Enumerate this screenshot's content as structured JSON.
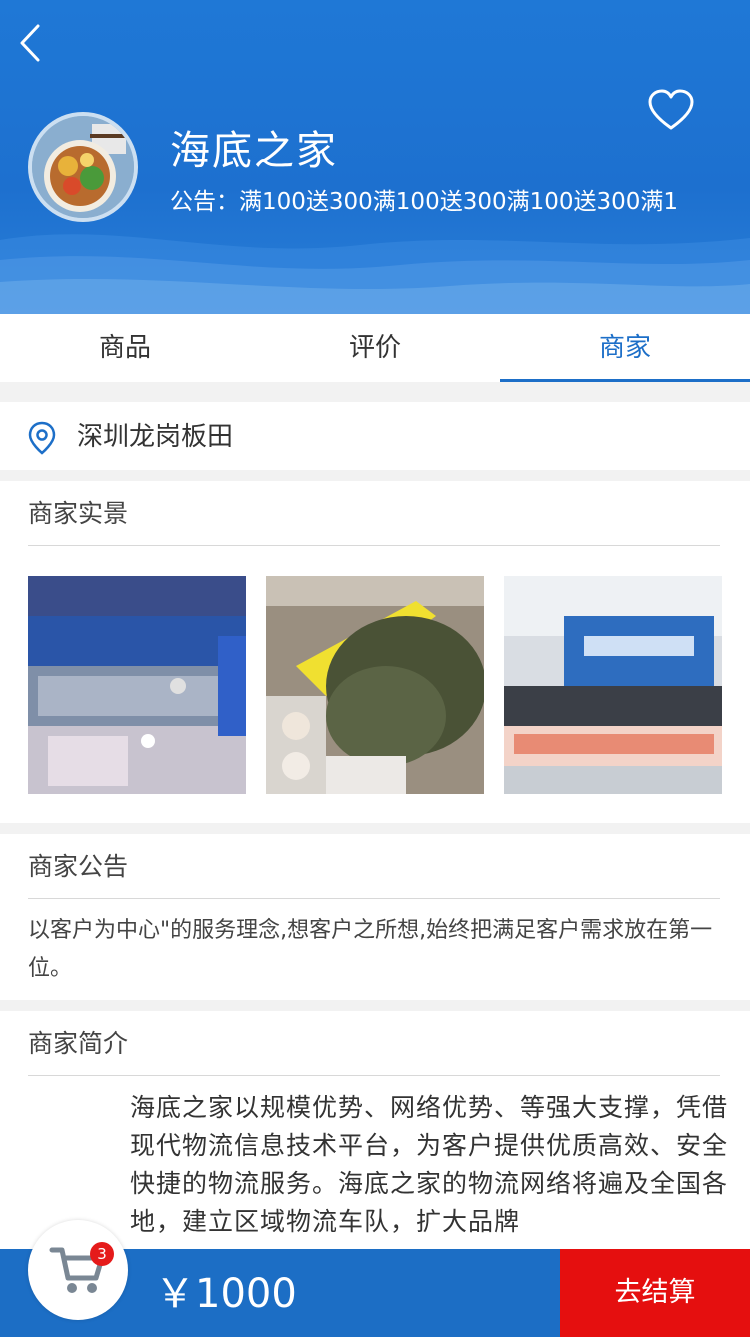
{
  "header": {
    "shop_name": "海底之家",
    "notice_prefix": "公告：",
    "notice_text": "满100送300满100送300满100送300满1"
  },
  "icons": {
    "back": "chevron-left-icon",
    "favorite": "heart-outline-icon",
    "location": "location-pin-icon",
    "cart": "shopping-cart-icon"
  },
  "tabs": [
    {
      "label": "商品"
    },
    {
      "label": "评价"
    },
    {
      "label": "商家"
    }
  ],
  "active_tab": "商家",
  "address": {
    "text": "深圳龙岗板田"
  },
  "scene": {
    "title": "商家实景"
  },
  "notice_section": {
    "title": "商家公告",
    "body": "以客户为中心\"的服务理念,想客户之所想,始终把满足客户需求放在第一位。"
  },
  "intro_section": {
    "title": "商家简介",
    "body": "海底之家以规模优势、网络优势、等强大支撑，凭借现代物流信息技术平台，为客户提供优质高效、安全快捷的物流服务。海底之家的物流网络将遍及全国各地，建立区域物流车队，扩大品牌"
  },
  "cart": {
    "count": "3",
    "price": "￥1000",
    "checkout_label": "去结算"
  },
  "colors": {
    "primary": "#1d6fc8",
    "checkout": "#e50f0f",
    "badge": "#e51b1b"
  }
}
